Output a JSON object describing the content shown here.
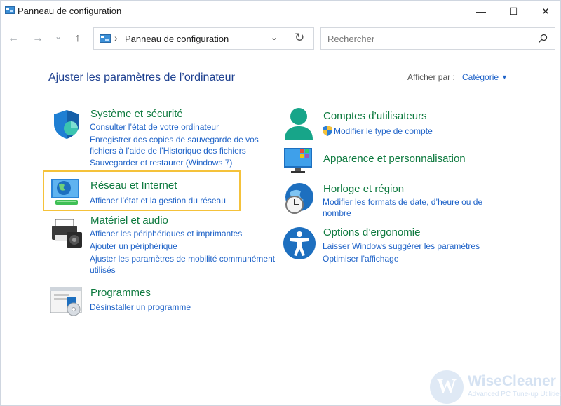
{
  "window": {
    "title": "Panneau de configuration",
    "min_glyph": "—",
    "max_glyph": "☐",
    "close_glyph": "✕"
  },
  "nav": {
    "back_glyph": "←",
    "forward_glyph": "→",
    "recent_glyph": "⌄",
    "up_glyph": "↑"
  },
  "address": {
    "separator": "›",
    "path": "Panneau de configuration",
    "dropdown_glyph": "⌄",
    "refresh_glyph": "↻"
  },
  "search": {
    "placeholder": "Rechercher"
  },
  "header": {
    "title": "Ajuster les paramètres de l’ordinateur",
    "view_label": "Afficher par :",
    "view_value": "Catégorie",
    "view_caret": "▼"
  },
  "categories": {
    "system": {
      "title": "Système et sécurité",
      "links": [
        "Consulter l’état de votre ordinateur",
        "Enregistrer des copies de sauvegarde de vos",
        "fichiers à l’aide de l’Historique des fichiers",
        "Sauvegarder et restaurer (Windows 7)"
      ]
    },
    "network": {
      "title": "Réseau et Internet",
      "links": [
        "Afficher l’état et la gestion du réseau"
      ]
    },
    "hardware": {
      "title": "Matériel et audio",
      "links": [
        "Afficher les périphériques et imprimantes",
        "Ajouter un périphérique",
        "Ajuster les paramètres de mobilité communément",
        "utilisés"
      ]
    },
    "programs": {
      "title": "Programmes",
      "links": [
        "Désinstaller un programme"
      ]
    },
    "accounts": {
      "title": "Comptes d’utilisateurs",
      "links": [
        "Modifier le type de compte"
      ]
    },
    "appearance": {
      "title": "Apparence et personnalisation",
      "links": []
    },
    "clock": {
      "title": "Horloge et région",
      "links": [
        "Modifier les formats de date, d’heure ou de",
        "nombre"
      ]
    },
    "ease": {
      "title": "Options d’ergonomie",
      "links": [
        "Laisser Windows suggérer les paramètres",
        "Optimiser l’affichage"
      ]
    }
  },
  "watermark": {
    "letter": "W",
    "name": "WiseCleaner",
    "tagline": "Advanced PC Tune-up Utilities"
  },
  "colors": {
    "category_title": "#0e7a3f",
    "link": "#1f63c8",
    "page_title": "#1c3f8f",
    "highlight": "#f5c23a"
  }
}
